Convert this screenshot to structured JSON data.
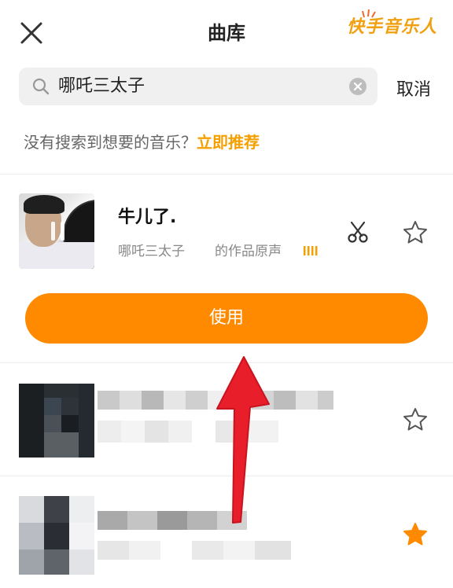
{
  "header": {
    "title": "曲库",
    "brand": "快手音乐人"
  },
  "search": {
    "query": "哪吒三太子",
    "cancel_label": "取消"
  },
  "hint": {
    "text": "没有搜索到想要的音乐？",
    "link": "立即推荐"
  },
  "songs": [
    {
      "title": "牛儿了.",
      "artist": "哪吒三太子",
      "source": "的作品原声",
      "playing": true,
      "favorited": false,
      "use_label": "使用"
    },
    {
      "favorited": false
    },
    {
      "favorited": true
    }
  ],
  "colors": {
    "accent": "#ff8a00",
    "link": "#f5a000",
    "brand": "#f0a010",
    "annotation_arrow": "#e81e2a"
  }
}
